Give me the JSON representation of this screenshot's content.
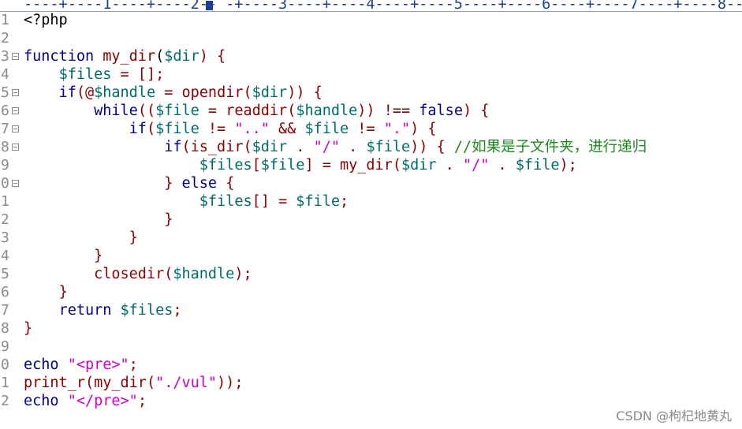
{
  "ruler": {
    "text": "----+----1----+----2-- -+----3----+----4----+----5----+----6----+----7----+----8--"
  },
  "gutter": {
    "line_numbers": [
      "1",
      "2",
      "3",
      "4",
      "5",
      "6",
      "7",
      "8",
      "9",
      "0",
      "1",
      "2",
      "3",
      "4",
      "5",
      "6",
      "7",
      "8",
      "9",
      "0",
      "1",
      "2"
    ]
  },
  "code_lines": [
    [
      {
        "t": "<?php",
        "c": "p"
      }
    ],
    [],
    [
      {
        "t": "function",
        "c": "k"
      },
      {
        "t": " ",
        "c": "p"
      },
      {
        "t": "my_dir",
        "c": "f"
      },
      {
        "t": "(",
        "c": "p"
      },
      {
        "t": "$dir",
        "c": "v"
      },
      {
        "t": ") {",
        "c": "o"
      }
    ],
    [
      {
        "t": "    ",
        "c": "p"
      },
      {
        "t": "$files",
        "c": "v"
      },
      {
        "t": " = [];",
        "c": "o"
      }
    ],
    [
      {
        "t": "    ",
        "c": "p"
      },
      {
        "t": "if",
        "c": "k"
      },
      {
        "t": "(@",
        "c": "o"
      },
      {
        "t": "$handle",
        "c": "v"
      },
      {
        "t": " = ",
        "c": "o"
      },
      {
        "t": "opendir",
        "c": "f"
      },
      {
        "t": "(",
        "c": "o"
      },
      {
        "t": "$dir",
        "c": "v"
      },
      {
        "t": ")) {",
        "c": "o"
      }
    ],
    [
      {
        "t": "        ",
        "c": "p"
      },
      {
        "t": "while",
        "c": "k"
      },
      {
        "t": "((",
        "c": "o"
      },
      {
        "t": "$file",
        "c": "v"
      },
      {
        "t": " = ",
        "c": "o"
      },
      {
        "t": "readdir",
        "c": "f"
      },
      {
        "t": "(",
        "c": "o"
      },
      {
        "t": "$handle",
        "c": "v"
      },
      {
        "t": ")) !== ",
        "c": "o"
      },
      {
        "t": "false",
        "c": "k"
      },
      {
        "t": ") {",
        "c": "o"
      }
    ],
    [
      {
        "t": "            ",
        "c": "p"
      },
      {
        "t": "if",
        "c": "k"
      },
      {
        "t": "(",
        "c": "o"
      },
      {
        "t": "$file",
        "c": "v"
      },
      {
        "t": " != ",
        "c": "o"
      },
      {
        "t": "\"..\"",
        "c": "s"
      },
      {
        "t": " && ",
        "c": "o"
      },
      {
        "t": "$file",
        "c": "v"
      },
      {
        "t": " != ",
        "c": "o"
      },
      {
        "t": "\".\"",
        "c": "s"
      },
      {
        "t": ") {",
        "c": "o"
      }
    ],
    [
      {
        "t": "                ",
        "c": "p"
      },
      {
        "t": "if",
        "c": "k"
      },
      {
        "t": "(",
        "c": "o"
      },
      {
        "t": "is_dir",
        "c": "f"
      },
      {
        "t": "(",
        "c": "o"
      },
      {
        "t": "$dir",
        "c": "v"
      },
      {
        "t": " . ",
        "c": "o"
      },
      {
        "t": "\"/\"",
        "c": "s"
      },
      {
        "t": " . ",
        "c": "o"
      },
      {
        "t": "$file",
        "c": "v"
      },
      {
        "t": ")) { ",
        "c": "o"
      },
      {
        "t": "//如果是子文件夹，进行递归",
        "c": "c"
      }
    ],
    [
      {
        "t": "                    ",
        "c": "p"
      },
      {
        "t": "$files",
        "c": "v"
      },
      {
        "t": "[",
        "c": "o"
      },
      {
        "t": "$file",
        "c": "v"
      },
      {
        "t": "] = ",
        "c": "o"
      },
      {
        "t": "my_dir",
        "c": "f"
      },
      {
        "t": "(",
        "c": "o"
      },
      {
        "t": "$dir",
        "c": "v"
      },
      {
        "t": " . ",
        "c": "o"
      },
      {
        "t": "\"/\"",
        "c": "s"
      },
      {
        "t": " . ",
        "c": "o"
      },
      {
        "t": "$file",
        "c": "v"
      },
      {
        "t": ");",
        "c": "o"
      }
    ],
    [
      {
        "t": "                ",
        "c": "p"
      },
      {
        "t": "} ",
        "c": "o"
      },
      {
        "t": "else",
        "c": "k"
      },
      {
        "t": " {",
        "c": "o"
      }
    ],
    [
      {
        "t": "                    ",
        "c": "p"
      },
      {
        "t": "$files",
        "c": "v"
      },
      {
        "t": "[] = ",
        "c": "o"
      },
      {
        "t": "$file",
        "c": "v"
      },
      {
        "t": ";",
        "c": "o"
      }
    ],
    [
      {
        "t": "                ",
        "c": "p"
      },
      {
        "t": "}",
        "c": "o"
      }
    ],
    [
      {
        "t": "            ",
        "c": "p"
      },
      {
        "t": "}",
        "c": "o"
      }
    ],
    [
      {
        "t": "        ",
        "c": "p"
      },
      {
        "t": "}",
        "c": "o"
      }
    ],
    [
      {
        "t": "        ",
        "c": "p"
      },
      {
        "t": "closedir",
        "c": "f"
      },
      {
        "t": "(",
        "c": "o"
      },
      {
        "t": "$handle",
        "c": "v"
      },
      {
        "t": ");",
        "c": "o"
      }
    ],
    [
      {
        "t": "    ",
        "c": "p"
      },
      {
        "t": "}",
        "c": "o"
      }
    ],
    [
      {
        "t": "    ",
        "c": "p"
      },
      {
        "t": "return",
        "c": "k"
      },
      {
        "t": " ",
        "c": "p"
      },
      {
        "t": "$files",
        "c": "v"
      },
      {
        "t": ";",
        "c": "o"
      }
    ],
    [
      {
        "t": "}",
        "c": "o"
      }
    ],
    [],
    [
      {
        "t": "echo",
        "c": "k"
      },
      {
        "t": " ",
        "c": "p"
      },
      {
        "t": "\"<pre>\"",
        "c": "s"
      },
      {
        "t": ";",
        "c": "o"
      }
    ],
    [
      {
        "t": "print_r",
        "c": "f"
      },
      {
        "t": "(",
        "c": "o"
      },
      {
        "t": "my_dir",
        "c": "f"
      },
      {
        "t": "(",
        "c": "o"
      },
      {
        "t": "\"./vul\"",
        "c": "s"
      },
      {
        "t": "));",
        "c": "o"
      }
    ],
    [
      {
        "t": "echo",
        "c": "k"
      },
      {
        "t": " ",
        "c": "p"
      },
      {
        "t": "\"</pre>\"",
        "c": "s"
      },
      {
        "t": ";",
        "c": "o"
      }
    ]
  ],
  "fold_markers": [
    2,
    4,
    5,
    6,
    7,
    9
  ],
  "watermark": "CSDN @枸杞地黄丸"
}
